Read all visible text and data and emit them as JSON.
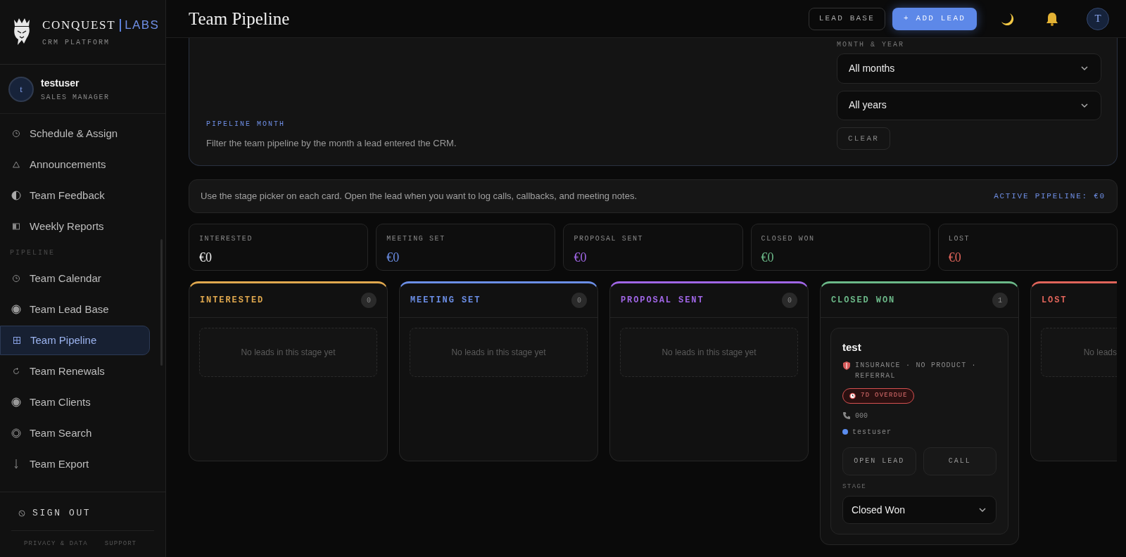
{
  "brand": {
    "name": "CONQUEST",
    "suffix": "LABS",
    "tagline": "CRM PLATFORM"
  },
  "user": {
    "initial": "t",
    "name": "testuser",
    "role": "SALES MANAGER"
  },
  "nav": [
    {
      "items": [
        {
          "label": "Schedule & Assign",
          "selected": false
        },
        {
          "label": "Announcements",
          "selected": false
        },
        {
          "label": "Team Feedback",
          "selected": false
        },
        {
          "label": "Weekly Reports",
          "selected": false
        }
      ]
    },
    {
      "heading": "PIPELINE",
      "items": [
        {
          "label": "Team Calendar",
          "selected": false
        },
        {
          "label": "Team Lead Base",
          "selected": false
        },
        {
          "label": "Team Pipeline",
          "selected": true
        },
        {
          "label": "Team Renewals",
          "selected": false
        },
        {
          "label": "Team Clients",
          "selected": false
        },
        {
          "label": "Team Search",
          "selected": false
        },
        {
          "label": "Team Export",
          "selected": false
        }
      ]
    }
  ],
  "sign_out": "SIGN OUT",
  "footer_links": [
    "PRIVACY & DATA",
    "SUPPORT"
  ],
  "header": {
    "title": "Team Pipeline",
    "buttons": [
      {
        "label": "LEAD BASE",
        "kind": "outline"
      },
      {
        "label": "+ ADD LEAD",
        "kind": "primary"
      }
    ],
    "avatar": "T"
  },
  "filter": {
    "label": "PIPELINE MONTH",
    "description": "Filter the team pipeline by the month a lead entered the CRM.",
    "field_label": "MONTH & YEAR",
    "selects": [
      {
        "value": "All months"
      },
      {
        "value": "All years"
      }
    ],
    "clear": "CLEAR"
  },
  "info": {
    "text": "Use the stage picker on each card. Open the lead when you want to log calls, callbacks, and meeting notes.",
    "total": "ACTIVE PIPELINE: €0"
  },
  "totals": [
    {
      "label": "INTERESTED",
      "amount": "€0",
      "color": "#ededed"
    },
    {
      "label": "MEETING SET",
      "amount": "€0",
      "color": "#6b8ee6"
    },
    {
      "label": "PROPOSAL SENT",
      "amount": "€0",
      "color": "#a066e6"
    },
    {
      "label": "CLOSED WON",
      "amount": "€0",
      "color": "#6bb888"
    },
    {
      "label": "LOST",
      "amount": "€0",
      "color": "#e0645a"
    }
  ],
  "stages": [
    {
      "label": "INTERESTED",
      "color": "#e0a84e",
      "count": "0",
      "placeholder": "No leads in this stage yet"
    },
    {
      "label": "MEETING SET",
      "color": "#6b8ee6",
      "count": "0",
      "placeholder": "No leads in this stage yet"
    },
    {
      "label": "PROPOSAL SENT",
      "color": "#a066e6",
      "count": "0",
      "placeholder": "No leads in this stage yet"
    },
    {
      "label": "CLOSED WON",
      "color": "#6bb888",
      "count": "1",
      "leads": [
        {
          "title": "test",
          "meta": "INSURANCE · NO PRODUCT · REFERRAL",
          "badge": "7D OVERDUE",
          "phone": "000",
          "owner": "testuser",
          "actions": [
            "OPEN LEAD",
            "CALL"
          ],
          "stage_label": "STAGE",
          "stage_value": "Closed Won"
        }
      ]
    },
    {
      "label": "LOST",
      "color": "#e0645a",
      "placeholder": "No leads"
    }
  ]
}
